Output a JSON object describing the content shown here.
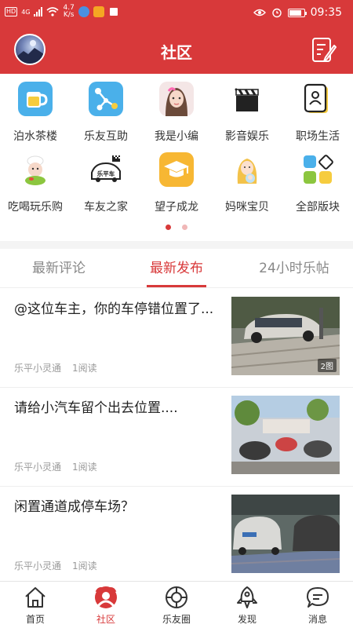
{
  "status_bar": {
    "network": "4G",
    "speed_value": "4.7",
    "speed_unit": "K/s",
    "time": "09:35"
  },
  "header": {
    "title": "社区"
  },
  "grid": {
    "items": [
      {
        "label": "泊水茶楼",
        "icon": "tea-cup-icon"
      },
      {
        "label": "乐友互助",
        "icon": "share-nodes-icon"
      },
      {
        "label": "我是小编",
        "icon": "editor-girl-avatar"
      },
      {
        "label": "影音娱乐",
        "icon": "clapperboard-icon"
      },
      {
        "label": "职场生活",
        "icon": "id-card-icon"
      },
      {
        "label": "吃喝玩乐购",
        "icon": "chef-icon"
      },
      {
        "label": "车友之家",
        "icon": "car-club-icon"
      },
      {
        "label": "望子成龙",
        "icon": "graduation-cap-icon"
      },
      {
        "label": "妈咪宝贝",
        "icon": "mother-baby-icon"
      },
      {
        "label": "全部版块",
        "icon": "all-sections-icon"
      }
    ],
    "car_logo_text": "乐平车",
    "page_dots": {
      "count": 2,
      "active": 0
    }
  },
  "tabs": [
    {
      "label": "最新评论",
      "active": false
    },
    {
      "label": "最新发布",
      "active": true
    },
    {
      "label": "24小时乐帖",
      "active": false
    }
  ],
  "posts": [
    {
      "title": "@这位车主，你的车停错位置了...",
      "author": "乐平小灵通",
      "reads": "1阅读",
      "image_count": "2图"
    },
    {
      "title": "请给小汽车留个出去位置....",
      "author": "乐平小灵通",
      "reads": "1阅读",
      "image_count": ""
    },
    {
      "title": "闲置通道成停车场？",
      "author": "乐平小灵通",
      "reads": "1阅读",
      "image_count": ""
    }
  ],
  "bottom_nav": [
    {
      "label": "首页",
      "icon": "home-icon",
      "active": false
    },
    {
      "label": "社区",
      "icon": "community-icon",
      "active": true
    },
    {
      "label": "乐友圈",
      "icon": "friends-circle-icon",
      "active": false
    },
    {
      "label": "发现",
      "icon": "rocket-icon",
      "active": false
    },
    {
      "label": "消息",
      "icon": "message-icon",
      "active": false
    }
  ],
  "colors": {
    "brand_red": "#d8393a",
    "text_dark": "#222222",
    "text_muted": "#999999",
    "dot_active": "#d8393a",
    "dot_inactive": "#f0b7b7"
  }
}
